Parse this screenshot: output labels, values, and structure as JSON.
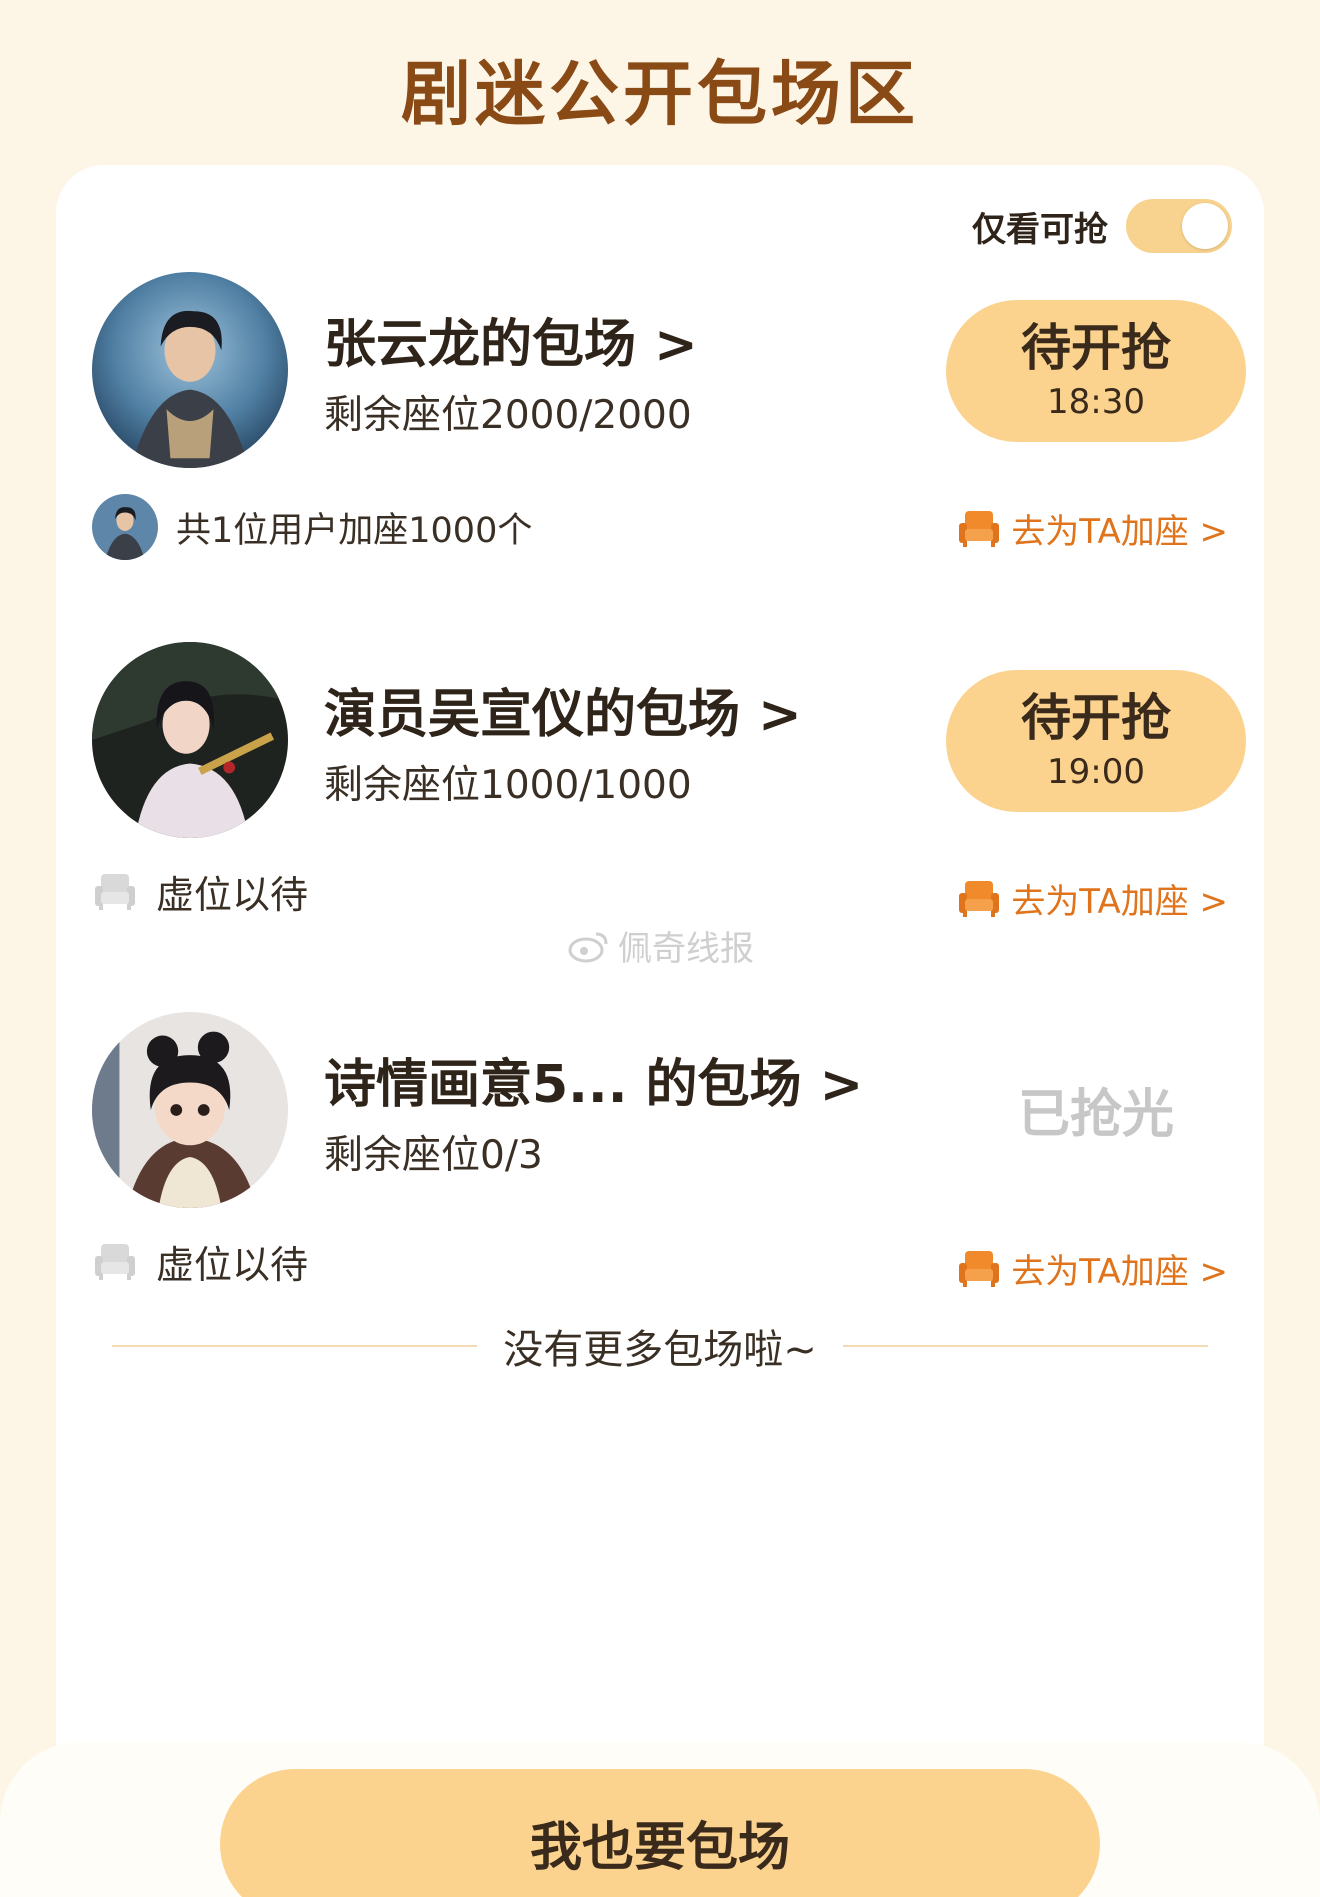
{
  "page_title": "剧迷公开包场区",
  "filter": {
    "label": "仅看可抢",
    "toggle_on": true
  },
  "sessions": [
    {
      "title": "张云龙的包场 >",
      "seats": "剩余座位2000/2000",
      "button_main": "待开抢",
      "button_time": "18:30",
      "footer": "共1位用户加座1000个",
      "add_seat": "去为TA加座 >"
    },
    {
      "title": "演员吴宣仪的包场 >",
      "seats": "剩余座位1000/1000",
      "button_main": "待开抢",
      "button_time": "19:00",
      "footer": "虚位以待",
      "add_seat": "去为TA加座 >"
    },
    {
      "title": "诗情画意5... 的包场 >",
      "seats": "剩余座位0/3",
      "status": "已抢光",
      "footer": "虚位以待",
      "add_seat": "去为TA加座 >"
    }
  ],
  "end_text": "没有更多包场啦~",
  "watermark": "佩奇线报",
  "cta_label": "我也要包场",
  "colors": {
    "accent": "#fbd38f",
    "title": "#8a4a16",
    "orange": "#e0741c",
    "background": "#fdf6e6"
  }
}
